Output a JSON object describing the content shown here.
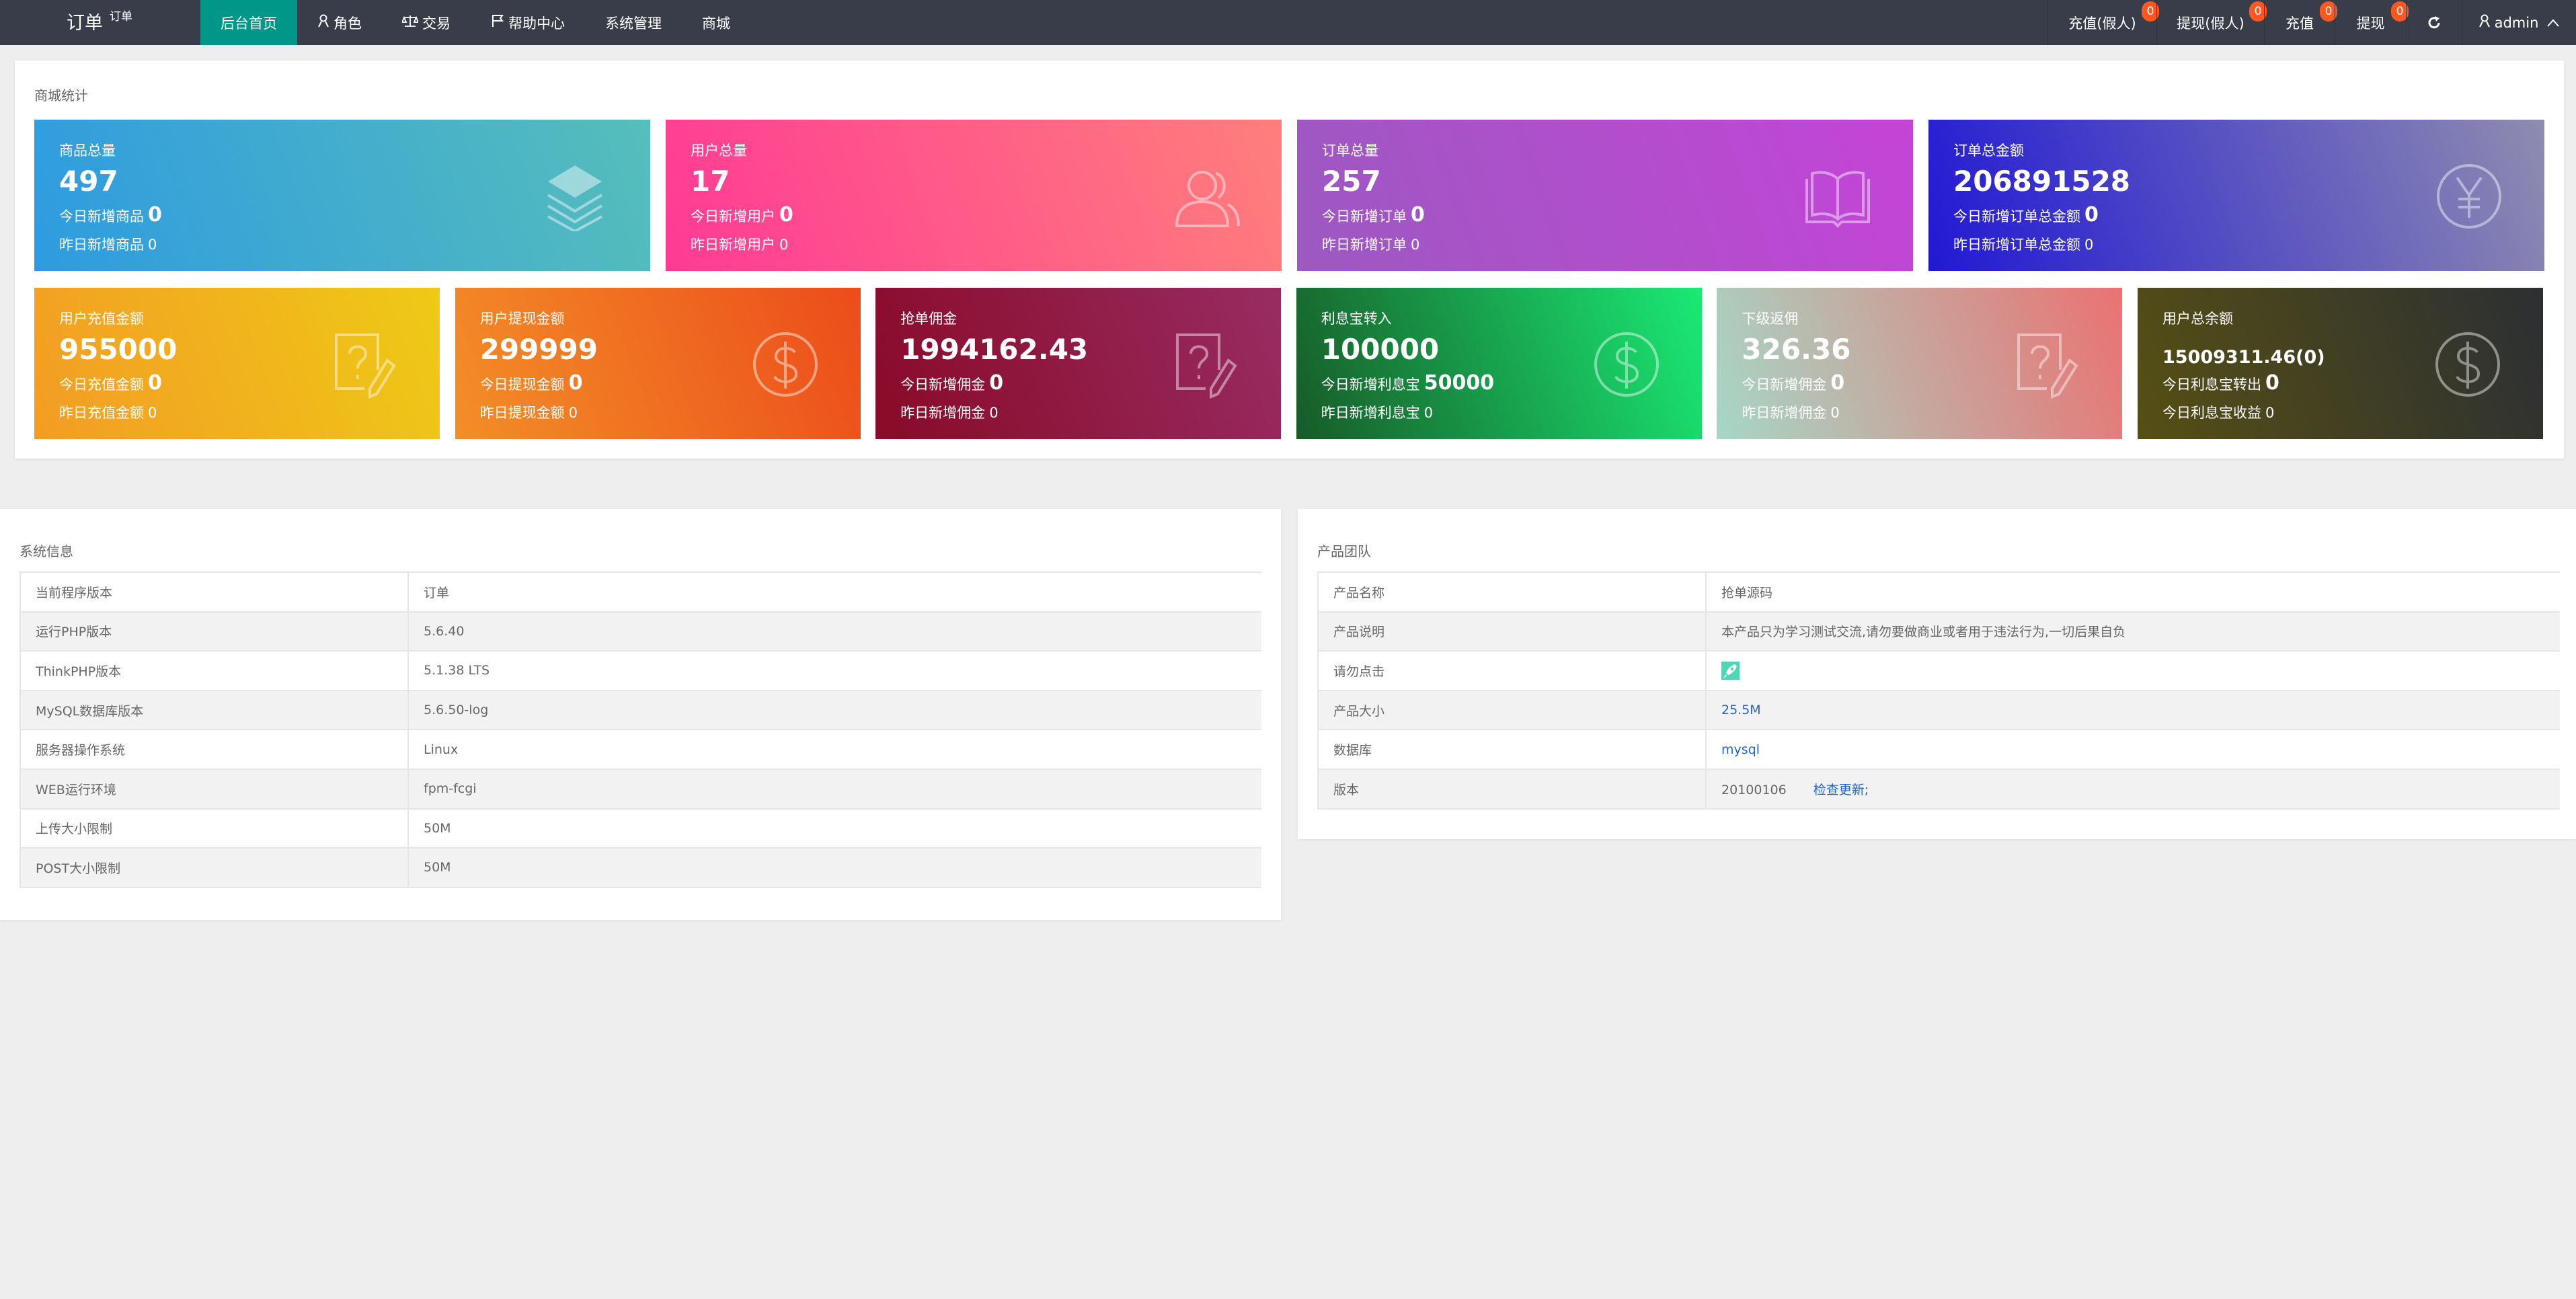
{
  "header": {
    "logo": "订单",
    "logo_sup": "订单",
    "nav": [
      {
        "label": "后台首页",
        "icon": "",
        "active": true
      },
      {
        "label": "角色",
        "icon": "user-icon"
      },
      {
        "label": "交易",
        "icon": "scale-icon"
      },
      {
        "label": "帮助中心",
        "icon": "flag-icon"
      },
      {
        "label": "系统管理",
        "icon": ""
      },
      {
        "label": "商城",
        "icon": ""
      }
    ],
    "right": [
      {
        "label": "充值(假人)",
        "badge": "0"
      },
      {
        "label": "提现(假人)",
        "badge": "0"
      },
      {
        "label": "充值",
        "badge": "0"
      },
      {
        "label": "提现",
        "badge": "0"
      }
    ],
    "refresh_icon": "refresh-icon",
    "user": "admin"
  },
  "stats": {
    "title": "商城统计",
    "cards": [
      {
        "label": "商品总量",
        "value": "497",
        "today_label": "今日新增商品",
        "today_value": "0",
        "yesterday_label": "昨日新增商品",
        "yesterday_value": "0",
        "icon": "layers-icon",
        "colors": [
          "#2e9be0",
          "#56bebb"
        ]
      },
      {
        "label": "用户总量",
        "value": "17",
        "today_label": "今日新增用户",
        "today_value": "0",
        "yesterday_label": "昨日新增用户",
        "yesterday_value": "0",
        "icon": "users-icon",
        "colors": [
          "#ff3a95",
          "#ff7f7b"
        ]
      },
      {
        "label": "订单总量",
        "value": "257",
        "today_label": "今日新增订单",
        "today_value": "0",
        "yesterday_label": "昨日新增订单",
        "yesterday_value": "0",
        "icon": "book-icon",
        "colors": [
          "#9c59c1",
          "#c444d7"
        ]
      },
      {
        "label": "订单总金额",
        "value": "206891528",
        "today_label": "今日新增订单总金额",
        "today_value": "0",
        "yesterday_label": "昨日新增订单总金额",
        "yesterday_value": "0",
        "icon": "yen-icon",
        "colors": [
          "#2118d4",
          "#8f8cb0"
        ]
      },
      {
        "label": "用户充值金额",
        "value": "955000",
        "today_label": "今日充值金额",
        "today_value": "0",
        "yesterday_label": "昨日充值金额",
        "yesterday_value": "0",
        "icon": "question-edit-icon",
        "colors": [
          "#f39c24",
          "#eeca16"
        ]
      },
      {
        "label": "用户提现金额",
        "value": "299999",
        "today_label": "今日提现金额",
        "today_value": "0",
        "yesterday_label": "昨日提现金额",
        "yesterday_value": "0",
        "icon": "dollar-icon",
        "colors": [
          "#f38e27",
          "#ec4c1b"
        ]
      },
      {
        "label": "抢单佣金",
        "value": "1994162.43",
        "today_label": "今日新增佣金",
        "today_value": "0",
        "yesterday_label": "昨日新增佣金",
        "yesterday_value": "0",
        "icon": "question-edit-icon",
        "colors": [
          "#890a28",
          "#982c62"
        ]
      },
      {
        "label": "利息宝转入",
        "value": "100000",
        "today_label": "今日新增利息宝",
        "today_value": "50000",
        "yesterday_label": "昨日新增利息宝",
        "yesterday_value": "0",
        "icon": "dollar-icon",
        "colors": [
          "#175b28",
          "#1aea74"
        ]
      },
      {
        "label": "下级返佣",
        "value": "326.36",
        "today_label": "今日新增佣金",
        "today_value": "0",
        "yesterday_label": "昨日新增佣金",
        "yesterday_value": "0",
        "icon": "question-edit-icon",
        "colors": [
          "#a6d7c6",
          "#ea7272"
        ]
      },
      {
        "label": "用户总余额",
        "value": "15009311.46(0)",
        "today_label": "今日利息宝转出",
        "today_value": "0",
        "yesterday_label": "今日利息宝收益",
        "yesterday_value": "0",
        "icon": "dollar-icon",
        "colors": [
          "#564f14",
          "#2c2f33"
        ]
      }
    ]
  },
  "system": {
    "title": "系统信息",
    "rows": [
      [
        "当前程序版本",
        "订单"
      ],
      [
        "运行PHP版本",
        "5.6.40"
      ],
      [
        "ThinkPHP版本",
        "5.1.38 LTS"
      ],
      [
        "MySQL数据库版本",
        "5.6.50-log"
      ],
      [
        "服务器操作系统",
        "Linux"
      ],
      [
        "WEB运行环境",
        "fpm-fcgi"
      ],
      [
        "上传大小限制",
        "50M"
      ],
      [
        "POST大小限制",
        "50M"
      ]
    ]
  },
  "team": {
    "title": "产品团队",
    "name_label": "产品名称",
    "name": "抢单源码",
    "desc_label": "产品说明",
    "desc": "本产品只为学习测试交流,请勿要做商业或者用于违法行为,一切后果自负",
    "noclick_label": "请勿点击",
    "noclick_icon": "rocket-icon",
    "size_label": "产品大小",
    "size": "25.5M",
    "db_label": "数据库",
    "db": "mysql",
    "version_label": "版本",
    "version": "20100106",
    "update_link": "检查更新;"
  }
}
